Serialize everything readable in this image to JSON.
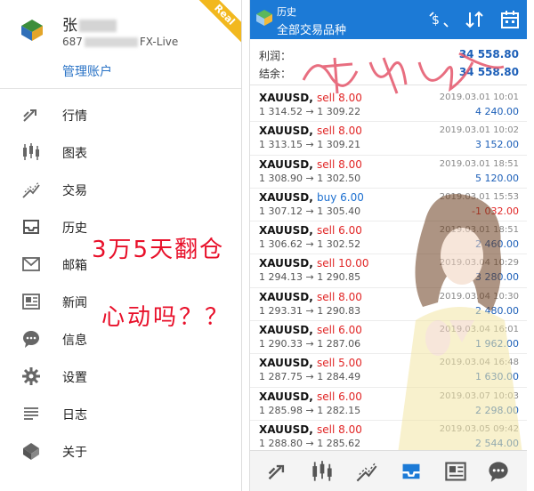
{
  "drawer": {
    "account_name": "张",
    "account_num_prefix": "687",
    "account_num_suffix": "FX-Live",
    "manage_label": "管理账户",
    "badge": "Real",
    "menu": [
      {
        "label": "行情",
        "icon": "trend-icon"
      },
      {
        "label": "图表",
        "icon": "candlestick-icon"
      },
      {
        "label": "交易",
        "icon": "trade-icon"
      },
      {
        "label": "历史",
        "icon": "inbox-icon"
      },
      {
        "label": "邮箱",
        "icon": "mail-icon"
      },
      {
        "label": "新闻",
        "icon": "news-icon"
      },
      {
        "label": "信息",
        "icon": "chat-icon"
      },
      {
        "label": "设置",
        "icon": "gear-icon"
      },
      {
        "label": "日志",
        "icon": "log-icon"
      },
      {
        "label": "关于",
        "icon": "about-icon"
      }
    ]
  },
  "promo": {
    "line1": "3万5天翻仓",
    "line2": "心动吗？？"
  },
  "app": {
    "title": "历史",
    "subtitle": "全部交易品种",
    "profit_label": "利润：",
    "profit_value": "34 558.80",
    "balance_label": "结余：",
    "balance_value": "34 558.80",
    "trades": [
      {
        "sym": "XAUUSD,",
        "dir": "sell 8.00",
        "type": "sell",
        "price": "1 314.52 → 1 309.22",
        "date": "2019.03.01 10:01",
        "pl": "4 240.00"
      },
      {
        "sym": "XAUUSD,",
        "dir": "sell 8.00",
        "type": "sell",
        "price": "1 313.15 → 1 309.21",
        "date": "2019.03.01 10:02",
        "pl": "3 152.00"
      },
      {
        "sym": "XAUUSD,",
        "dir": "sell 8.00",
        "type": "sell",
        "price": "1 308.90 → 1 302.50",
        "date": "2019.03.01 18:51",
        "pl": "5 120.00"
      },
      {
        "sym": "XAUUSD,",
        "dir": "buy 6.00",
        "type": "buy",
        "price": "1 307.12 → 1 305.40",
        "date": "2019.03.01 15:53",
        "pl": "-1 032.00"
      },
      {
        "sym": "XAUUSD,",
        "dir": "sell 6.00",
        "type": "sell",
        "price": "1 306.62 → 1 302.52",
        "date": "2019.03.01 18:51",
        "pl": "2 460.00"
      },
      {
        "sym": "XAUUSD,",
        "dir": "sell 10.00",
        "type": "sell",
        "price": "1 294.13 → 1 290.85",
        "date": "2019.03.04 10:29",
        "pl": "3 280.00"
      },
      {
        "sym": "XAUUSD,",
        "dir": "sell 8.00",
        "type": "sell",
        "price": "1 293.31 → 1 290.83",
        "date": "2019.03.04 10:30",
        "pl": "2 480.00"
      },
      {
        "sym": "XAUUSD,",
        "dir": "sell 6.00",
        "type": "sell",
        "price": "1 290.33 → 1 287.06",
        "date": "2019.03.04 16:01",
        "pl": "1 962.00"
      },
      {
        "sym": "XAUUSD,",
        "dir": "sell 5.00",
        "type": "sell",
        "price": "1 287.75 → 1 284.49",
        "date": "2019.03.04 16:48",
        "pl": "1 630.00"
      },
      {
        "sym": "XAUUSD,",
        "dir": "sell 6.00",
        "type": "sell",
        "price": "1 285.98 → 1 282.15",
        "date": "2019.03.07 10:03",
        "pl": "2 298.00"
      },
      {
        "sym": "XAUUSD,",
        "dir": "sell 8.00",
        "type": "sell",
        "price": "1 288.80 → 1 285.62",
        "date": "2019.03.05 09:42",
        "pl": "2 544.00"
      }
    ],
    "bottom_nav": [
      "trend-icon",
      "candlestick-icon",
      "trade-icon",
      "inbox-icon",
      "news-icon",
      "chat-icon"
    ],
    "colors": {
      "accent": "#1c7ad6",
      "sell": "#e12525",
      "buy": "#1c6fd0",
      "promo": "#e8102a",
      "badge": "#f2b81e"
    }
  }
}
